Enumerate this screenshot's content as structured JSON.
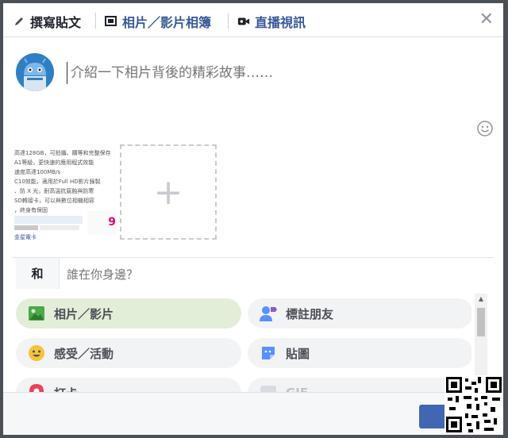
{
  "tabs": [
    {
      "label": "撰寫貼文",
      "icon": "pencil-icon",
      "active": true
    },
    {
      "label": "相片／影片相簿",
      "icon": "photo-album-icon",
      "active": false
    },
    {
      "label": "直播視訊",
      "icon": "video-camera-icon",
      "active": false
    }
  ],
  "composer": {
    "placeholder": "介紹一下相片背後的精彩故事……"
  },
  "attachment": {
    "lines": [
      "高達128GB，可拍攝、購等和完整保存",
      "A1等級，更快速的應用程式效能",
      "速度高達100MB/s",
      "C10效能，適用於Full HD影片錄製",
      "、防 X 光，耐高溫抗腐蝕與防寒",
      "SD轉接卡，可以與數位相機相容",
      "，終身有保固"
    ],
    "price_text": "9",
    "link_text": "金星電卡"
  },
  "with_row": {
    "label": "和",
    "placeholder": "誰在你身邊？"
  },
  "options": [
    {
      "label": "相片／影片",
      "icon": "photo-icon",
      "active": true,
      "disabled": false
    },
    {
      "label": "標註朋友",
      "icon": "tag-friends-icon",
      "active": false,
      "disabled": false
    },
    {
      "label": "感受／活動",
      "icon": "smiley-icon",
      "active": false,
      "disabled": false
    },
    {
      "label": "貼圖",
      "icon": "sticker-icon",
      "active": false,
      "disabled": false
    },
    {
      "label": "打卡",
      "icon": "location-pin-icon",
      "active": false,
      "disabled": false
    },
    {
      "label": "GIF",
      "icon": "gif-icon",
      "active": false,
      "disabled": true
    }
  ],
  "colors": {
    "brand": "#4267b2",
    "active_pill": "#e2eed8",
    "pill": "#f2f3f5"
  }
}
